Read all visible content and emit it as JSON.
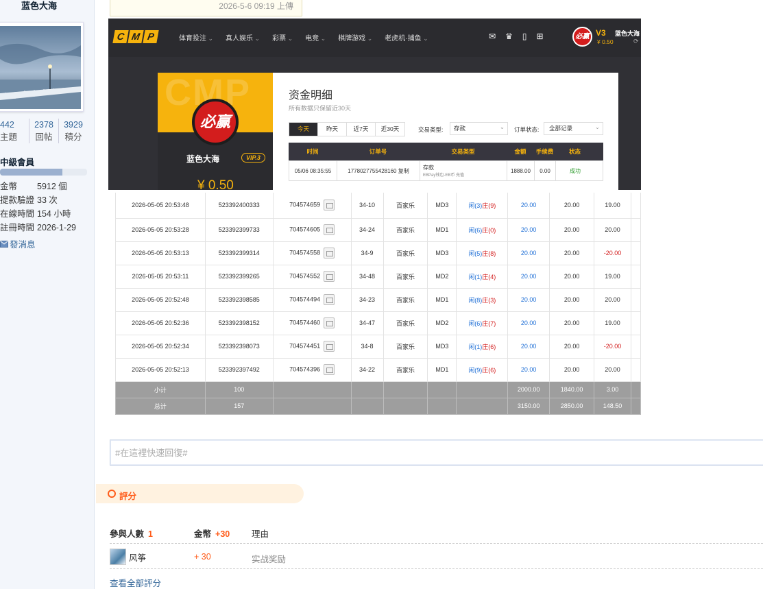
{
  "profile": {
    "name": "蓝色大海",
    "stats": [
      {
        "value": "442",
        "label": "主題"
      },
      {
        "value": "2378",
        "label": "回帖"
      },
      {
        "value": "3929",
        "label": "積分"
      }
    ],
    "group": "中級會員",
    "info": [
      {
        "key": "金幣",
        "value": "5912 個"
      },
      {
        "key": "提款驗證",
        "value": "33 次"
      },
      {
        "key": "在線時間",
        "value": "154 小時"
      },
      {
        "key": "註冊時間",
        "value": "2026-1-29"
      }
    ],
    "message_label": "發消息"
  },
  "upload_tip": "2026-5-6 09:19 上傳",
  "screenshot": {
    "logo_letters": [
      "C",
      "M",
      "P"
    ],
    "nav": [
      "体育投注",
      "真人娱乐",
      "彩票",
      "电竞",
      "棋牌游戏",
      "老虎机·捕鱼"
    ],
    "badge": "必赢",
    "vip_level": "V3",
    "header_balance": "¥ 0.50",
    "header_user": "蓝色大海",
    "card": {
      "watermark": "CMP",
      "logo": "必赢",
      "name": "蓝色大海",
      "vip": "VIP.3",
      "balance": "¥ 0.50"
    },
    "panel": {
      "title": "资金明细",
      "subtitle": "所有数据只保留近30天",
      "tabs": [
        "今天",
        "昨天",
        "近7天",
        "近30天"
      ],
      "trade_type_label": "交易类型:",
      "trade_type_value": "存款",
      "order_status_label": "订单状态:",
      "order_status_value": "全部记录",
      "columns": [
        "时间",
        "订单号",
        "交易类型",
        "金额",
        "手续费",
        "状态"
      ],
      "row": {
        "time": "05/06 08:35:55",
        "order": "1778027755428160",
        "copy": "复制",
        "type": "存款",
        "type_sub": "EBPay钱包-EB币 充值",
        "amount": "1888.00",
        "fee": "0.00",
        "status": "成功"
      }
    },
    "bets": [
      {
        "time": "2026-05-05 20:53:48",
        "bet_no": "523392400333",
        "round": "704574659",
        "table": "34-10",
        "game": "百家乐",
        "md": "MD3",
        "xian": "闲(3)",
        "zhuang": "庄(9)",
        "bet": "20.00",
        "valid": "20.00",
        "win": "19.00"
      },
      {
        "time": "2026-05-05 20:53:28",
        "bet_no": "523392399733",
        "round": "704574605",
        "table": "34-24",
        "game": "百家乐",
        "md": "MD1",
        "xian": "闲(6)",
        "zhuang": "庄(0)",
        "bet": "20.00",
        "valid": "20.00",
        "win": "20.00"
      },
      {
        "time": "2026-05-05 20:53:13",
        "bet_no": "523392399314",
        "round": "704574558",
        "table": "34-9",
        "game": "百家乐",
        "md": "MD3",
        "xian": "闲(5)",
        "zhuang": "庄(8)",
        "bet": "20.00",
        "valid": "20.00",
        "win": "-20.00"
      },
      {
        "time": "2026-05-05 20:53:11",
        "bet_no": "523392399265",
        "round": "704574552",
        "table": "34-48",
        "game": "百家乐",
        "md": "MD2",
        "xian": "闲(1)",
        "zhuang": "庄(4)",
        "bet": "20.00",
        "valid": "20.00",
        "win": "19.00"
      },
      {
        "time": "2026-05-05 20:52:48",
        "bet_no": "523392398585",
        "round": "704574494",
        "table": "34-23",
        "game": "百家乐",
        "md": "MD1",
        "xian": "闲(8)",
        "zhuang": "庄(3)",
        "bet": "20.00",
        "valid": "20.00",
        "win": "20.00"
      },
      {
        "time": "2026-05-05 20:52:36",
        "bet_no": "523392398152",
        "round": "704574460",
        "table": "34-47",
        "game": "百家乐",
        "md": "MD2",
        "xian": "闲(6)",
        "zhuang": "庄(7)",
        "bet": "20.00",
        "valid": "20.00",
        "win": "19.00"
      },
      {
        "time": "2026-05-05 20:52:34",
        "bet_no": "523392398073",
        "round": "704574451",
        "table": "34-8",
        "game": "百家乐",
        "md": "MD3",
        "xian": "闲(1)",
        "zhuang": "庄(6)",
        "bet": "20.00",
        "valid": "20.00",
        "win": "-20.00"
      },
      {
        "time": "2026-05-05 20:52:13",
        "bet_no": "523392397492",
        "round": "704574396",
        "table": "34-22",
        "game": "百家乐",
        "md": "MD1",
        "xian": "闲(9)",
        "zhuang": "庄(6)",
        "bet": "20.00",
        "valid": "20.00",
        "win": "20.00"
      }
    ],
    "subtotal": {
      "label": "小计",
      "count": "100",
      "bet": "2000.00",
      "valid": "1840.00",
      "win": "3.00"
    },
    "total": {
      "label": "总计",
      "count": "157",
      "bet": "3150.00",
      "valid": "2850.00",
      "win": "148.50"
    }
  },
  "reply": {
    "placeholder": "#在這裡快速回復#"
  },
  "rating": {
    "title": "評分",
    "participants_label": "參與人數",
    "participants_count": "1",
    "coins_label": "金幣",
    "coins_total": "+30",
    "reason_label": "理由",
    "entries": [
      {
        "user": "风筝",
        "points": "+ 30",
        "reason": "实战奖励"
      }
    ],
    "view_all": "查看全部評分"
  },
  "colors": {
    "accent": "#ff5c1a",
    "link": "#336699",
    "cmp_gold": "#f6b30d",
    "cmp_dark": "#2b2b2f",
    "xian_blue": "#1f6fd6",
    "zhuang_red": "#d31d1d"
  }
}
